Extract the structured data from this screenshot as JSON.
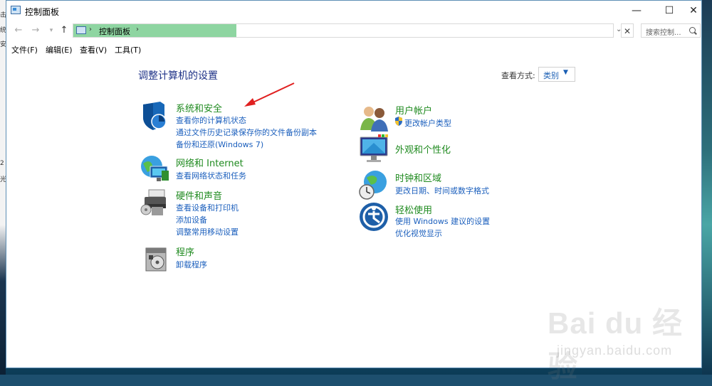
{
  "window": {
    "title": "控制面板"
  },
  "nav": {
    "crumb": "控制面板",
    "search_placeholder": "搜索控制..."
  },
  "menu": [
    "文件(F)",
    "编辑(E)",
    "查看(V)",
    "工具(T)"
  ],
  "main": {
    "heading": "调整计算机的设置",
    "view_by_label": "查看方式:",
    "view_by_value": "类别"
  },
  "categories": {
    "system_security": {
      "title": "系统和安全",
      "links": [
        "查看你的计算机状态",
        "通过文件历史记录保存你的文件备份副本",
        "备份和还原(Windows 7)"
      ]
    },
    "network": {
      "title": "网络和 Internet",
      "links": [
        "查看网络状态和任务"
      ]
    },
    "hardware": {
      "title": "硬件和声音",
      "links": [
        "查看设备和打印机",
        "添加设备",
        "调整常用移动设置"
      ]
    },
    "programs": {
      "title": "程序",
      "links": [
        "卸载程序"
      ]
    },
    "accounts": {
      "title": "用户帐户",
      "links": [
        "更改帐户类型"
      ]
    },
    "appearance": {
      "title": "外观和个性化",
      "links": []
    },
    "clock": {
      "title": "时钟和区域",
      "links": [
        "更改日期、时间或数字格式"
      ]
    },
    "ease": {
      "title": "轻松使用",
      "links": [
        "使用 Windows 建议的设置",
        "优化视觉显示"
      ]
    }
  },
  "watermark": {
    "brand": "Bai du 经验",
    "url": "jingyan.baidu.com"
  },
  "colors": {
    "category_title": "#1f8a1f",
    "link": "#1b5fbd",
    "heading": "#1e3287",
    "address_highlight": "#8ed5a1",
    "annotation_arrow": "#e02020"
  },
  "desktop_fragments": [
    "击",
    "统",
    "安",
    "2",
    "光"
  ]
}
